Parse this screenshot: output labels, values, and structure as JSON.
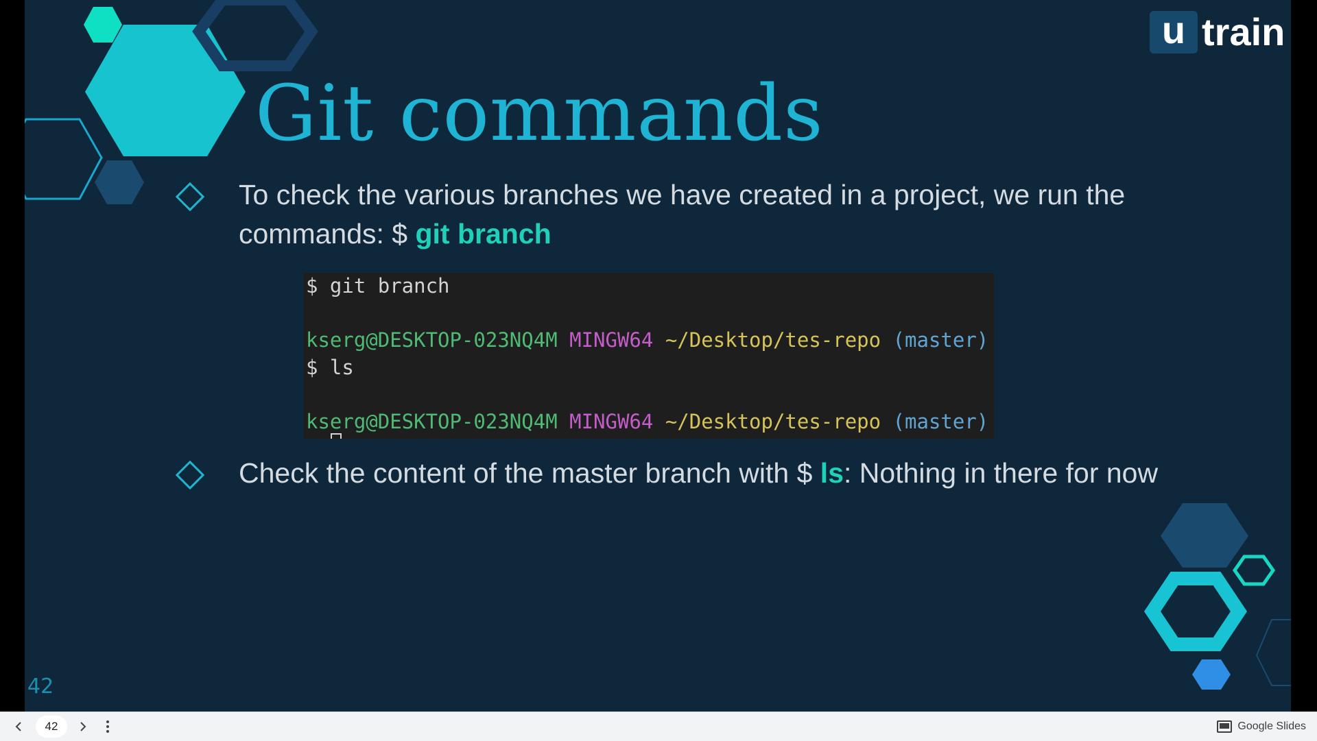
{
  "slide": {
    "title": "Git commands",
    "bullets": [
      {
        "text_before": "To check the various branches we have created in a project, we run the commands: $ ",
        "highlight": "git branch",
        "text_after": ""
      },
      {
        "text_before": "Check the content of the master branch with $ ",
        "highlight": "ls",
        "text_after": ": Nothing in there for now"
      }
    ],
    "terminal": {
      "line1": "$ git branch",
      "prompt_user": "kserg@DESKTOP-023NQ4M",
      "prompt_system": "MINGW64",
      "prompt_path": "~/Desktop/tes-repo",
      "prompt_branch": "(master)",
      "line3": "$ ls"
    },
    "slide_number": "42",
    "logo": {
      "mark": "u",
      "word": "train"
    }
  },
  "player_bar": {
    "page_number": "42",
    "brand": "Google Slides",
    "icons": [
      "chevron-left-icon",
      "chevron-right-icon",
      "more-vert-icon",
      "slides-icon"
    ]
  },
  "colors": {
    "slide_bg": "#0f273b",
    "title": "#1fb3d4",
    "highlight": "#1ed1b8",
    "body_text": "#d4dbe1"
  }
}
